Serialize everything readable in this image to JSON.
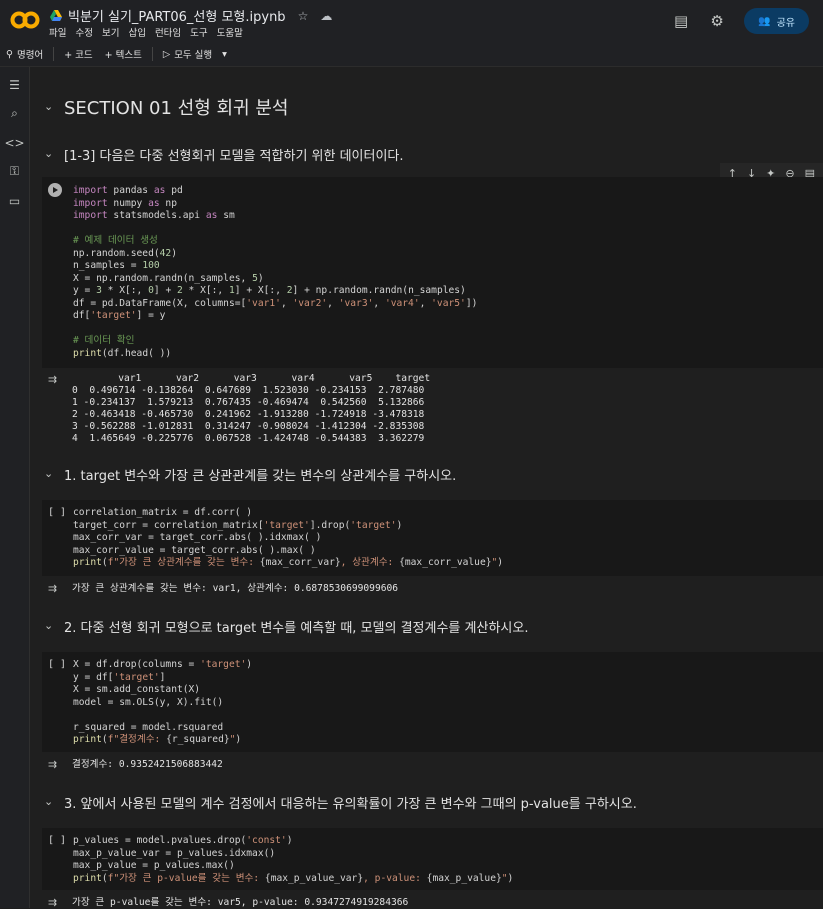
{
  "header": {
    "doc_title": "빅분기 실기_PART06_선형 모형.ipynb",
    "menu": [
      "파일",
      "수정",
      "보기",
      "삽입",
      "런타임",
      "도구",
      "도움말"
    ],
    "share_label": "공유"
  },
  "toolbar": {
    "command_label": "명령어",
    "code_label": "+ 코드",
    "text_label": "+ 텍스트",
    "run_all_label": "모두 실행"
  },
  "section": {
    "title": "SECTION 01 선형 회귀 분석",
    "intro": "[1-3] 다음은 다중 선형회귀 모델을 적합하기 위한 데이터이다.",
    "q1": "1. target 변수와 가장 큰 상관관계를 갖는 변수의 상관계수를 구하시오.",
    "q2": "2. 다중 선형 회귀 모형으로 target 변수를 예측할 때, 모델의 결정계수를 계산하시오.",
    "q3": "3. 앞에서 사용된 모델의 계수 검정에서 대응하는 유의확률이 가장 큰 변수와 그때의 p-value를 구하시오."
  },
  "cells": {
    "bracket": "[ ]",
    "out0": "        var1      var2      var3      var4      var5    target\n0  0.496714 -0.138264  0.647689  1.523030 -0.234153  2.787480\n1 -0.234137  1.579213  0.767435 -0.469474  0.542560  5.132866\n2 -0.463418 -0.465730  0.241962 -1.913280 -1.724918 -3.478318\n3 -0.562288 -1.012831  0.314247 -0.908024 -1.412304 -2.835308\n4  1.465649 -0.225776  0.067528 -1.424748 -0.544383  3.362279",
    "out1": "가장 큰 상관계수를 갖는 변수: var1, 상관계수: 0.6878530699099606",
    "out2": "결정계수: 0.9352421506883442",
    "out3": "가장 큰 p-value를 갖는 변수: var5, p-value: 0.9347274919284366"
  }
}
